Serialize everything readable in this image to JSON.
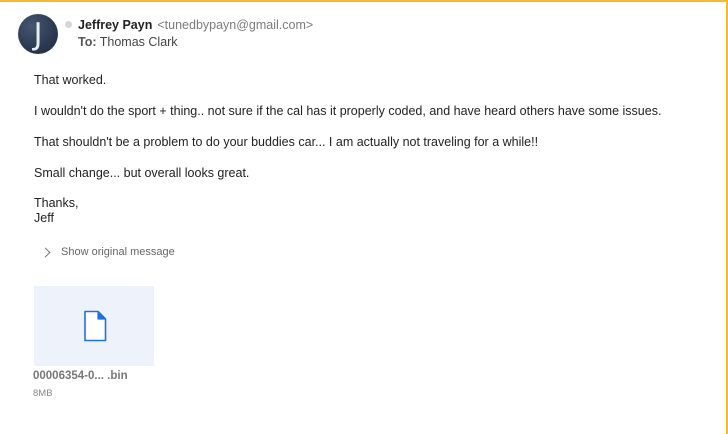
{
  "avatar": {
    "letter": "J"
  },
  "sender": {
    "name": "Jeffrey Payn",
    "email": "<tunedbypayn@gmail.com>"
  },
  "recipient": {
    "label": "To:",
    "name": "Thomas Clark"
  },
  "message": {
    "paragraphs": [
      "That worked.",
      "I wouldn't do the sport + thing.. not sure if the cal has it properly coded, and have heard others have some issues.",
      "That shouldn't be a problem to do your buddies car... I am actually not traveling for a while!!",
      "Small change... but overall looks great."
    ],
    "signoff": "Thanks,",
    "signature": "Jeff"
  },
  "show_original": {
    "label": "Show original message"
  },
  "attachment": {
    "name": "00006354-0...  .bin",
    "size": "8MB",
    "icon": "file-icon"
  },
  "colors": {
    "frame_border": "#f5b82e",
    "attachment_bg": "#eef3fb",
    "file_icon": "#1a73e8"
  }
}
